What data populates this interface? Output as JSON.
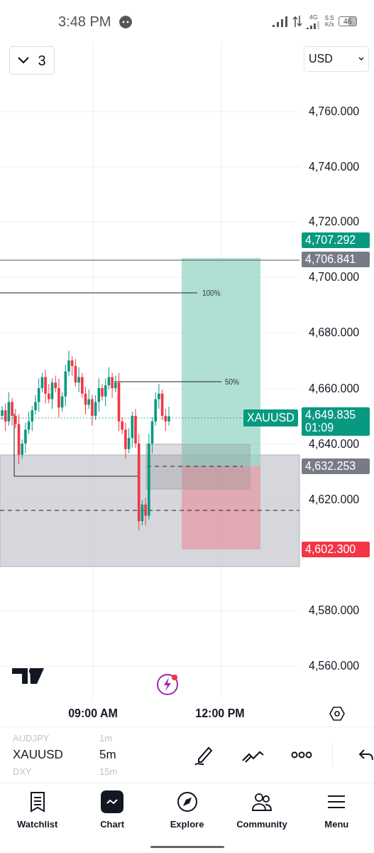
{
  "status_bar": {
    "time": "3:48 PM",
    "network": "4G",
    "speed_value": "5.5",
    "speed_unit": "K/s",
    "battery": "46"
  },
  "layout_button": {
    "label": "3"
  },
  "currency_select": {
    "value": "USD"
  },
  "price_axis": [
    "4,760.000",
    "4,740.000",
    "4,720.000",
    "4,700.000",
    "4,680.000",
    "4,660.000",
    "4,640.000",
    "4,620.000",
    "4,580.000",
    "4,560.000"
  ],
  "price_tags": [
    {
      "kind": "target",
      "price": "4,707.292"
    },
    {
      "kind": "level",
      "price": "4,706.841"
    },
    {
      "kind": "last",
      "symbol": "XAUUSD",
      "price": "4,649.835",
      "countdown": "01:09"
    },
    {
      "kind": "level",
      "price": "4,632.253"
    },
    {
      "kind": "stop",
      "price": "4,602.300"
    }
  ],
  "fib_labels": [
    "100%",
    "50%"
  ],
  "time_axis": [
    "09:00 AM",
    "12:00 PM"
  ],
  "symbols": [
    {
      "symbol": "AUDJPY",
      "interval": "1m",
      "selected": false
    },
    {
      "symbol": "XAUUSD",
      "interval": "5m",
      "selected": true
    },
    {
      "symbol": "DXY",
      "interval": "15m",
      "selected": false
    }
  ],
  "nav": [
    {
      "label": "Watchlist",
      "kind": "watchlist",
      "selected": false
    },
    {
      "label": "Chart",
      "kind": "chart",
      "selected": true
    },
    {
      "label": "Explore",
      "kind": "explore",
      "selected": false
    },
    {
      "label": "Community",
      "kind": "community",
      "selected": false
    },
    {
      "label": "Menu",
      "kind": "menu",
      "selected": false
    }
  ]
}
